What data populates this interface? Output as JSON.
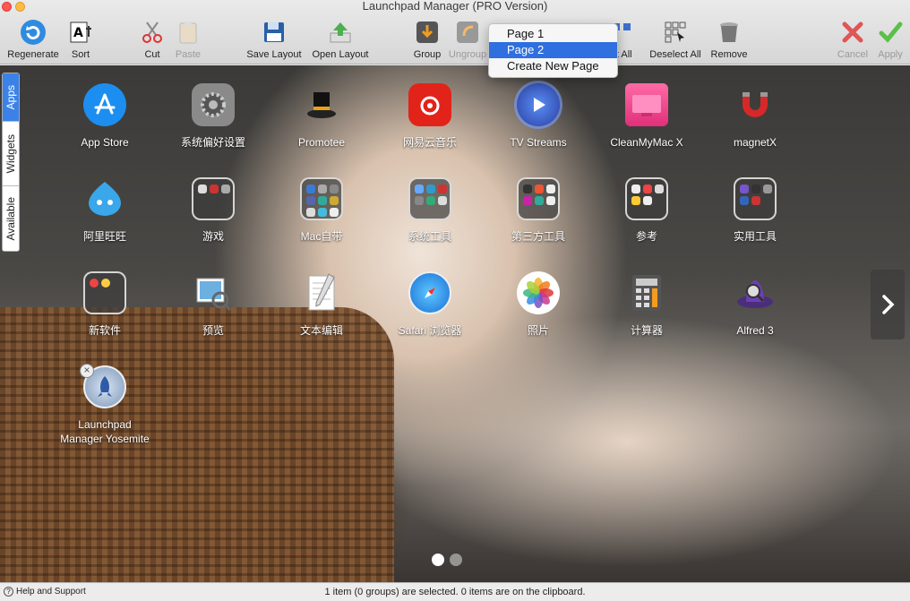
{
  "window": {
    "title": "Launchpad Manager (PRO Version)"
  },
  "toolbar": {
    "regenerate": "Regenerate",
    "sort": "Sort",
    "cut": "Cut",
    "paste": "Paste",
    "save_layout": "Save Layout",
    "open_layout": "Open Layout",
    "group": "Group",
    "ungroup": "Ungroup",
    "select_all": "ct All",
    "deselect_all": "Deselect All",
    "remove": "Remove",
    "cancel": "Cancel",
    "apply": "Apply"
  },
  "dropdown": {
    "items": [
      "Page 1",
      "Page 2",
      "Create New Page"
    ],
    "selected": "Page 2"
  },
  "sidetabs": [
    "Apps",
    "Widgets",
    "Available"
  ],
  "apps": {
    "row1": [
      "App Store",
      "系统偏好设置",
      "Promotee",
      "网易云音乐",
      "TV Streams",
      "CleanMyMac X",
      "magnetX"
    ],
    "row2": [
      "阿里旺旺",
      "游戏",
      "Mac自带",
      "系统工具",
      "第三方工具",
      "参考",
      "实用工具"
    ],
    "row3": [
      "新软件",
      "预览",
      "文本编辑",
      "Safari 浏览器",
      "照片",
      "计算器",
      "Alfred 3"
    ],
    "row4_line1": "Launchpad",
    "row4_line2": "Manager Yosemite"
  },
  "status": {
    "help": "Help and Support",
    "message": "1 item (0 groups) are selected. 0 items are on the clipboard."
  },
  "icons": {
    "regenerate": "refresh-icon",
    "sort": "sort-icon",
    "cut": "scissors-icon",
    "paste": "clipboard-icon",
    "save_layout": "floppy-icon",
    "open_layout": "open-arrow-icon",
    "group": "group-icon",
    "ungroup": "ungroup-icon",
    "deselect_all": "deselect-icon",
    "remove": "trash-icon",
    "cancel": "x-icon",
    "apply": "check-icon"
  },
  "colors": {
    "accent": "#2f6fdf",
    "cancel": "#e05555",
    "apply": "#5cbf4a"
  }
}
